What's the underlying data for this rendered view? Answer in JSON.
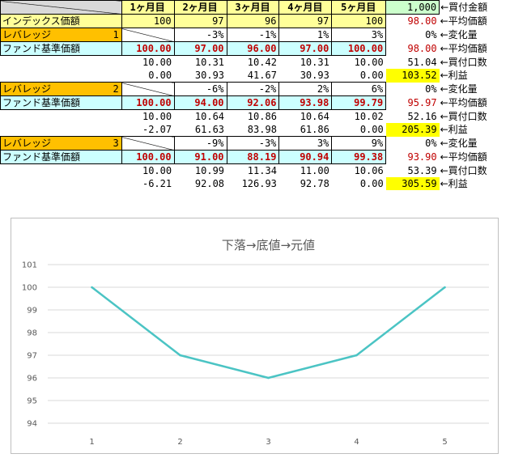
{
  "header": {
    "months": [
      "1ヶ月目",
      "2ヶ月目",
      "3ヶ月目",
      "4ヶ月目",
      "5ヶ月目"
    ],
    "purchase_amount": "1,000",
    "purchase_amount_label": "←買付金額"
  },
  "index_row": {
    "label": "インデックス価額",
    "values": [
      "100",
      "97",
      "96",
      "97",
      "100"
    ],
    "avg": "98.00",
    "avg_label": "←平均価額"
  },
  "levels": [
    {
      "label": "レバレッジ",
      "level": "1",
      "change": [
        "",
        "-3%",
        "-1%",
        "1%",
        "3%"
      ],
      "change_total": "0%",
      "change_label": "←変化量",
      "fund_label": "ファンド基準価額",
      "fund": [
        "100.00",
        "97.00",
        "96.00",
        "97.00",
        "100.00"
      ],
      "fund_avg": "98.00",
      "fund_avg_label": "←平均価額",
      "units": [
        "10.00",
        "10.31",
        "10.42",
        "10.31",
        "10.00"
      ],
      "units_total": "51.04",
      "units_label": "←買付口数",
      "profit": [
        "0.00",
        "30.93",
        "41.67",
        "30.93",
        "0.00"
      ],
      "profit_total": "103.52",
      "profit_label": "←利益"
    },
    {
      "label": "レバレッジ",
      "level": "2",
      "change": [
        "",
        "-6%",
        "-2%",
        "2%",
        "6%"
      ],
      "change_total": "0%",
      "change_label": "←変化量",
      "fund_label": "ファンド基準価額",
      "fund": [
        "100.00",
        "94.00",
        "92.06",
        "93.98",
        "99.79"
      ],
      "fund_avg": "95.97",
      "fund_avg_label": "←平均価額",
      "units": [
        "10.00",
        "10.64",
        "10.86",
        "10.64",
        "10.02"
      ],
      "units_total": "52.16",
      "units_label": "←買付口数",
      "profit": [
        "-2.07",
        "61.63",
        "83.98",
        "61.86",
        "0.00"
      ],
      "profit_total": "205.39",
      "profit_label": "←利益"
    },
    {
      "label": "レバレッジ",
      "level": "3",
      "change": [
        "",
        "-9%",
        "-3%",
        "3%",
        "9%"
      ],
      "change_total": "0%",
      "change_label": "←変化量",
      "fund_label": "ファンド基準価額",
      "fund": [
        "100.00",
        "91.00",
        "88.19",
        "90.94",
        "99.38"
      ],
      "fund_avg": "93.90",
      "fund_avg_label": "←平均価額",
      "units": [
        "10.00",
        "10.99",
        "11.34",
        "11.00",
        "10.06"
      ],
      "units_total": "53.39",
      "units_label": "←買付口数",
      "profit": [
        "-6.21",
        "92.08",
        "126.93",
        "92.78",
        "0.00"
      ],
      "profit_total": "305.59",
      "profit_label": "←利益"
    }
  ],
  "colors": {
    "line": "#4bc4c4",
    "header_yellow": "#ffff99",
    "leverage_orange": "#ffc000",
    "fund_cyan": "#ccffff",
    "profit_highlight": "#ffff00",
    "value_red": "#c00000"
  },
  "chart_data": {
    "type": "line",
    "title": "下落→底値→元値",
    "categories": [
      "1",
      "2",
      "3",
      "4",
      "5"
    ],
    "series": [
      {
        "values": [
          100,
          97,
          96,
          97,
          100
        ]
      }
    ],
    "ylim": [
      94,
      101
    ],
    "yticks": [
      "94",
      "95",
      "96",
      "97",
      "98",
      "99",
      "100",
      "101"
    ],
    "grid": true,
    "legend": "none"
  }
}
